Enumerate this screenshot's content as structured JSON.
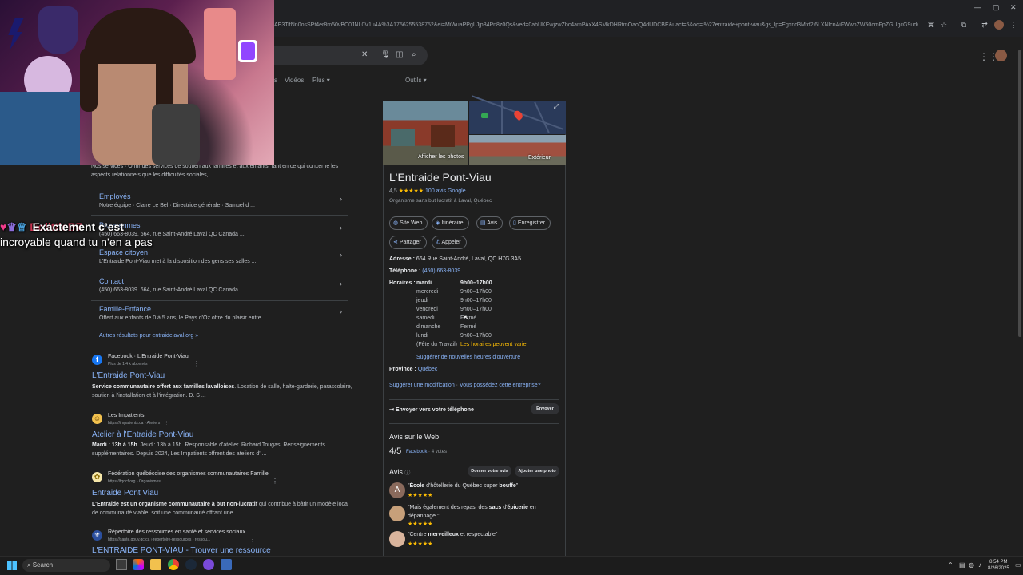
{
  "browser": {
    "url": "AE3TifNn0osSPt4er8m50vBC0JNL0V1u4A%3A1756255538752&ei=MiWuaPPgLJjp84Pn8z0Qs&ved=0ahUKEwjzwZbc4amPAxX4SMkDHRtmOaoQ4dUDCBE&uact=5&oq=l%27entraide+pont-viau&gs_lp=Egxnd3Mtd2l6LXNlcnAiFWwnZW50cmFpZGUgcG9udC12",
    "window_controls": [
      "—",
      "▢",
      "✕"
    ]
  },
  "search": {
    "tabs": [
      "Vidéos",
      "Plus",
      "Outils"
    ]
  },
  "chat": {
    "username": "DolittleB7",
    "message_line1": "Exactement c’est",
    "message_line2": "incroyable quand tu n’en a pas"
  },
  "left": {
    "intro_snippet": "Nos services · Offrir des services de soutien aux familles et aux enfants, tant en ce qui concerne les aspects relationnels que les difficultés sociales, ...",
    "sitelinks": [
      {
        "title": "Employés",
        "desc": "Notre équipe · Claire Le Bel · Directrice générale · Samuel d ..."
      },
      {
        "title": "Programmes",
        "desc": "(450) 663-8039. 664, rue Saint-André Laval QC Canada ..."
      },
      {
        "title": "Espace citoyen",
        "desc": "L'Entraide Pont-Viau met à la disposition des gens ses salles ..."
      },
      {
        "title": "Contact",
        "desc": "(450) 663-8039. 664, rue Saint-André Laval QC Canada ..."
      },
      {
        "title": "Famille-Enfance",
        "desc": "Offert aux enfants de 0 à 5 ans, le Pays d'Oz offre du plaisir entre ..."
      }
    ],
    "more_results": "Autres résultats pour entraidelaval.org »",
    "results": [
      {
        "source": "Facebook · L'Entraide Pont-Viau",
        "url": "Plus de 1,4 k abonnés",
        "title": "L'Entraide Pont-Viau",
        "snippet_bold": "Service communautaire offert aux familles lavalloises",
        "snippet": ". Location de salle, halte-garderie, parascolaire, soutien à l'installation et à l'intégration. D. S ...",
        "fav_color": "#1877f2",
        "fav_letter": "f"
      },
      {
        "source": "Les Impatients",
        "url": "https://impatients.ca › Ateliers",
        "title": "Atelier à l'Entraide Pont-Viau",
        "snippet_bold": "Mardi : 13h à 15h",
        "snippet": ". Jeudi: 13h à 15h. Responsable d'atelier. Richard Tougas. Renseignements supplémentaires. Depuis 2024, Les Impatients offrent des ateliers d' ...",
        "fav_color": "#f2c14e",
        "fav_letter": "☺"
      },
      {
        "source": "Fédération québécoise des organismes communautaires Famille",
        "url": "https://fqocf.org › Organismes",
        "title": "Entraide Pont Viau",
        "snippet_bold": "L'Entraide est un organisme communautaire à but non-lucratif",
        "snippet": " qui contribue à bâtir un modèle local de communauté viable, soit une communauté offrant une ...",
        "fav_color": "#f5e6a8",
        "fav_letter": "✿"
      },
      {
        "source": "Répertoire des ressources en santé et services sociaux",
        "url": "https://sante.gouv.qc.ca › repertoire-ressources › ressou...",
        "title": "L'ENTRAIDE PONT-VIAU - Trouver une ressource",
        "snippet_bold": "",
        "snippet": "",
        "fav_color": "#2b4f9e",
        "fav_letter": "⚜"
      }
    ]
  },
  "panel": {
    "photos_label": "Afficher les photos",
    "exterior_label": "Extérieur",
    "name": "L'Entraide Pont-Viau",
    "rating": "4,5",
    "stars": "★★★★★",
    "reviews_link": "100 avis Google",
    "category": "Organisme sans but lucratif à Laval, Québec",
    "actions": [
      {
        "icon": "◍",
        "label": "Site Web",
        "name": "website-button"
      },
      {
        "icon": "◈",
        "label": "Itinéraire",
        "name": "directions-button"
      },
      {
        "icon": "▤",
        "label": "Avis",
        "name": "reviews-button"
      },
      {
        "icon": "▯",
        "label": "Enregistrer",
        "name": "save-button"
      },
      {
        "icon": "⋖",
        "label": "Partager",
        "name": "share-button"
      },
      {
        "icon": "✆",
        "label": "Appeler",
        "name": "call-button"
      }
    ],
    "address_label": "Adresse :",
    "address": "664 Rue Saint-André, Laval, QC H7G 3A5",
    "phone_label": "Téléphone :",
    "phone": "(450) 663-8039",
    "hours_label": "Horaires :",
    "hours": [
      {
        "day": "mardi",
        "time": "9h00–17h00"
      },
      {
        "day": "mercredi",
        "time": "9h00–17h00"
      },
      {
        "day": "jeudi",
        "time": "9h00–17h00"
      },
      {
        "day": "vendredi",
        "time": "9h00–17h00"
      },
      {
        "day": "samedi",
        "time": "Fermé"
      },
      {
        "day": "dimanche",
        "time": "Fermé"
      },
      {
        "day": "lundi",
        "time": "9h00–17h00"
      }
    ],
    "holiday_note": "(Fête du Travail)",
    "holiday_warning": "Les horaires peuvent varier",
    "suggest_hours": "Suggérer de nouvelles heures d'ouverture",
    "province_label": "Province :",
    "province": "Québec",
    "suggest_edit": "Suggérer une modification",
    "own_business": "Vous possédez cette entreprise?",
    "send_phone": "Envoyer vers votre téléphone",
    "send_button": "Envoyer",
    "web_reviews_title": "Avis sur le Web",
    "web_score": "4/5",
    "web_source": "Facebook",
    "web_votes": "· 4 votes",
    "reviews_title": "Avis",
    "give_review": "Donner votre avis",
    "add_photo": "Ajouter une photo",
    "reviews": [
      {
        "pre": "\"",
        "bold1": "École",
        "mid": " d'hôtellerie du Québec super ",
        "bold2": "bouffe",
        "post": "\"",
        "avatar": "#8a6a5c",
        "letter": "A"
      },
      {
        "pre": "\"Mais également des repas, des ",
        "bold1": "sacs",
        "mid": " d'",
        "bold2": "épicerie",
        "post": " en dépannage.\"",
        "avatar": "#c7a07a",
        "letter": ""
      },
      {
        "pre": "\"Centre ",
        "bold1": "merveilleux",
        "mid": " et respectable",
        "bold2": "",
        "post": "\"",
        "avatar": "#d9b49c",
        "letter": ""
      }
    ],
    "review_stars": "★★★★★"
  },
  "taskbar": {
    "search_label": "Search",
    "time": "8:54 PM",
    "date": "8/26/2025"
  }
}
